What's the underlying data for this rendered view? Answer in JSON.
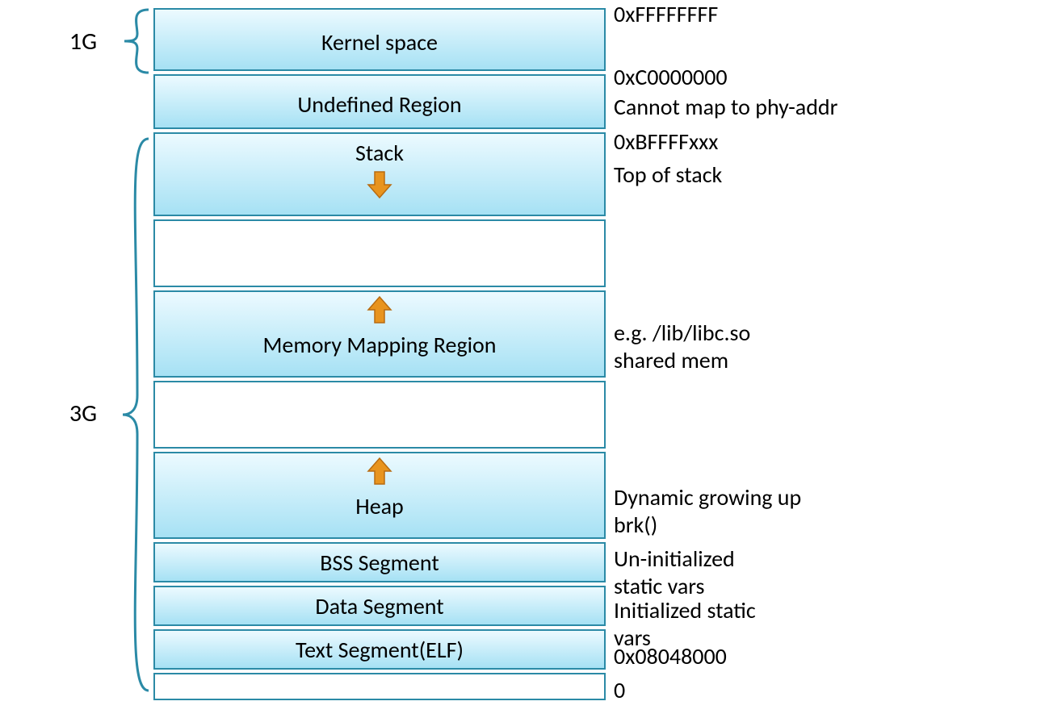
{
  "segments": {
    "kernel": "Kernel space",
    "undefined": "Undefined Region",
    "stack": "Stack",
    "mmap": "Memory Mapping Region",
    "heap": "Heap",
    "bss": "BSS Segment",
    "data": "Data Segment",
    "text": "Text Segment(ELF)"
  },
  "left_labels": {
    "kernel_size": "1G",
    "user_size": "3G"
  },
  "addresses": {
    "a_top": "0xFFFFFFFF",
    "a_kernel_end": "0xC0000000",
    "a_stack_top": "0xBFFFFxxx",
    "a_text_start": "0x08048000",
    "a_zero": "0"
  },
  "right_notes": {
    "undefined_note": "Cannot map to phy-addr",
    "stack_note": "Top of stack",
    "mmap_note1": "e.g. /lib/libc.so",
    "mmap_note2": "shared mem",
    "heap_note1": "Dynamic growing up",
    "heap_note2": "brk()",
    "bss_note1": "Un-initialized",
    "bss_note2": "static vars",
    "data_note1": "Initialized static",
    "data_note2": "vars"
  },
  "colors": {
    "border": "#2b8aa6",
    "fill_top": "#ecfaff",
    "fill_bottom": "#a6e1f4",
    "arrow_fill": "#e8941e",
    "arrow_stroke": "#b86b10"
  }
}
